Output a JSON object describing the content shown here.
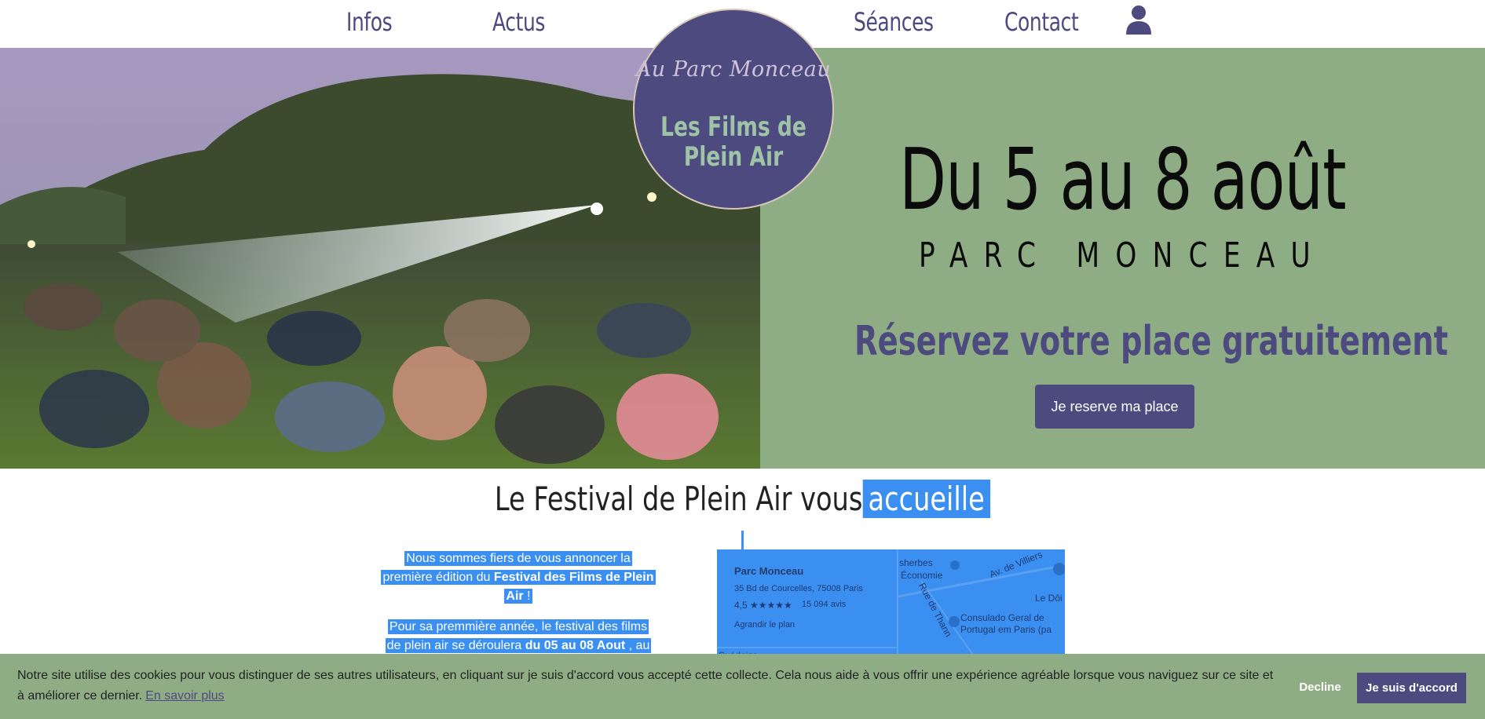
{
  "nav": {
    "items": [
      {
        "label": "Infos"
      },
      {
        "label": "Actus"
      },
      {
        "label": "Séances"
      },
      {
        "label": "Contact"
      }
    ],
    "user_icon": "user-icon"
  },
  "logo": {
    "script_text": "Au Parc Monceau",
    "title": "Les Films de Plein Air"
  },
  "hero": {
    "date": "Du 5 au 8 août",
    "place": "PARC MONCEAU",
    "reserve": "Réservez votre place gratuitement",
    "cta_label": "Je reserve ma place"
  },
  "section": {
    "title_plain": "Le Festival de Plein Air vous",
    "title_highlight": "accueille",
    "p1_before": "Nous sommes fiers de vous annoncer la première édition du",
    "p1_bold": "Festival des Films de Plein Air",
    "p1_after": "!",
    "p2_before": "Pour sa premmière année, le festival des films de plein air se déroulera",
    "p2_bold": "du 05 au 08 Aout",
    "p2_after": ", au"
  },
  "map": {
    "place_name": "Parc Monceau",
    "address": "35 Bd de Courcelles, 75008 Paris",
    "rating": "4,5 ★★★★★",
    "reviews": "15 094 avis",
    "enlarge": "Agrandir le plan",
    "labels": [
      "sherbes",
      "Économie",
      "Av. de Villiers",
      "Le Dôi",
      "Rue de Thann",
      "Consulado Geral de",
      "Portugal em Paris (pa",
      "Suédoise"
    ]
  },
  "cookie": {
    "text": "Notre site utilise des cookies pour vous distinguer de ses autres utilisateurs, en cliquant sur je suis d'accord vous accepté cette collecte. Cela nous aide à vous offrir une expérience agréable lorsque vous naviguez sur ce site et à améliorer ce dernier.",
    "link": "En savoir plus",
    "decline": "Decline",
    "accept": "Je suis d'accord"
  },
  "colors": {
    "brand_purple": "#4d4a80",
    "hero_green": "#8fad85",
    "selection_blue": "#3a8ff0"
  }
}
